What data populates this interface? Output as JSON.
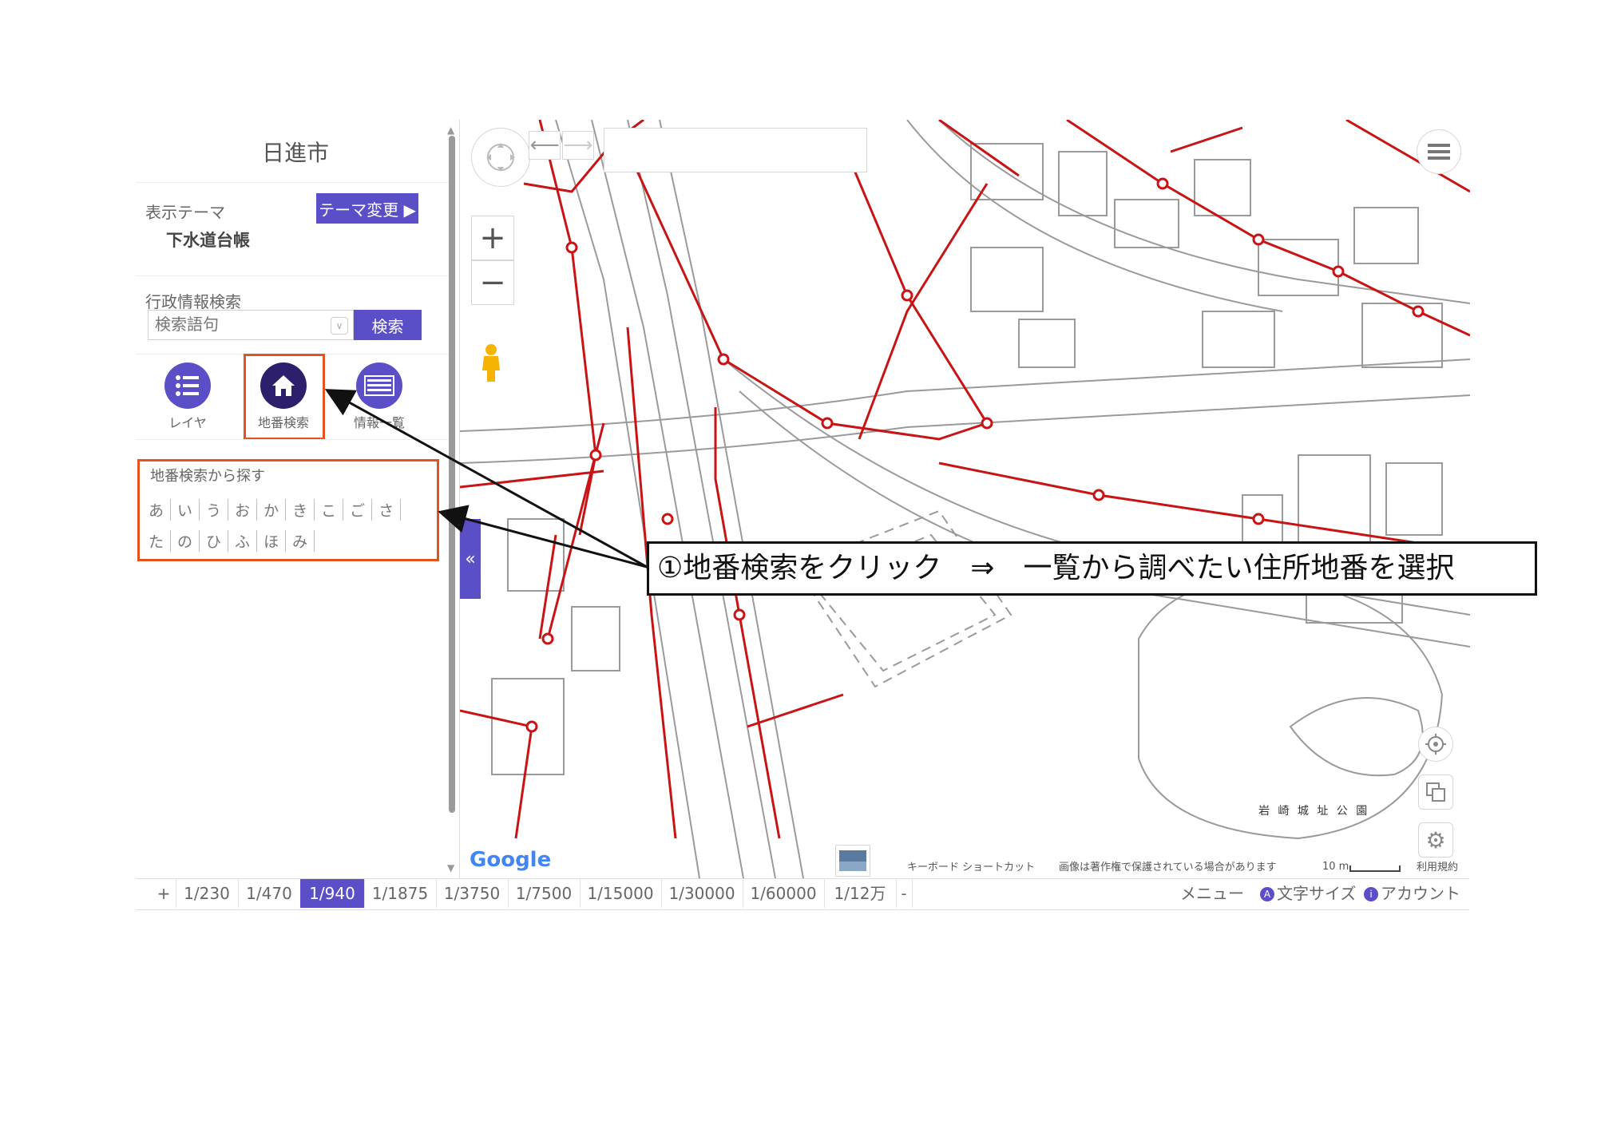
{
  "panel": {
    "city": "日進市",
    "theme_label": "表示テーマ",
    "theme_button": "テーマ変更 ▶",
    "theme_value": "下水道台帳",
    "search_section": "行政情報検索",
    "search_placeholder": "検索語句",
    "search_button": "検索",
    "tools": [
      {
        "label": "レイヤ",
        "icon": "layer-list-icon"
      },
      {
        "label": "地番検索",
        "icon": "home-icon"
      },
      {
        "label": "情報一覧",
        "icon": "info-list-icon"
      }
    ],
    "lot_search_title": "地番検索から探す",
    "kana_row1": [
      "あ",
      "い",
      "う",
      "お",
      "か",
      "き",
      "こ",
      "ご",
      "さ"
    ],
    "kana_row2": [
      "た",
      "の",
      "ひ",
      "ふ",
      "ほ",
      "み"
    ]
  },
  "map": {
    "collapse_label": "«",
    "park_label": "岩 崎 城 址 公 園",
    "credits": {
      "shortcuts": "キーボード ショートカット",
      "copyright": "画像は著作権で保護されている場合があります",
      "scale": "10 m",
      "terms": "利用規約"
    },
    "google": "Google"
  },
  "bottom": {
    "plus": "+",
    "minus": "-",
    "scales": [
      "1/230",
      "1/470",
      "1/940",
      "1/1875",
      "1/3750",
      "1/7500",
      "1/15000",
      "1/30000",
      "1/60000",
      "1/12万"
    ],
    "active_scale": "1/940",
    "menu": "メニュー",
    "font_size": "文字サイズ",
    "account": "アカウント",
    "font_badge": "A",
    "account_badge": "i"
  },
  "annotation": {
    "instruction": "①地番検索をクリック　⇒　一覧から調べたい住所地番を選択"
  },
  "colors": {
    "accent": "#5b4fc8",
    "highlight": "#e2531e",
    "sewer": "#c81414"
  }
}
